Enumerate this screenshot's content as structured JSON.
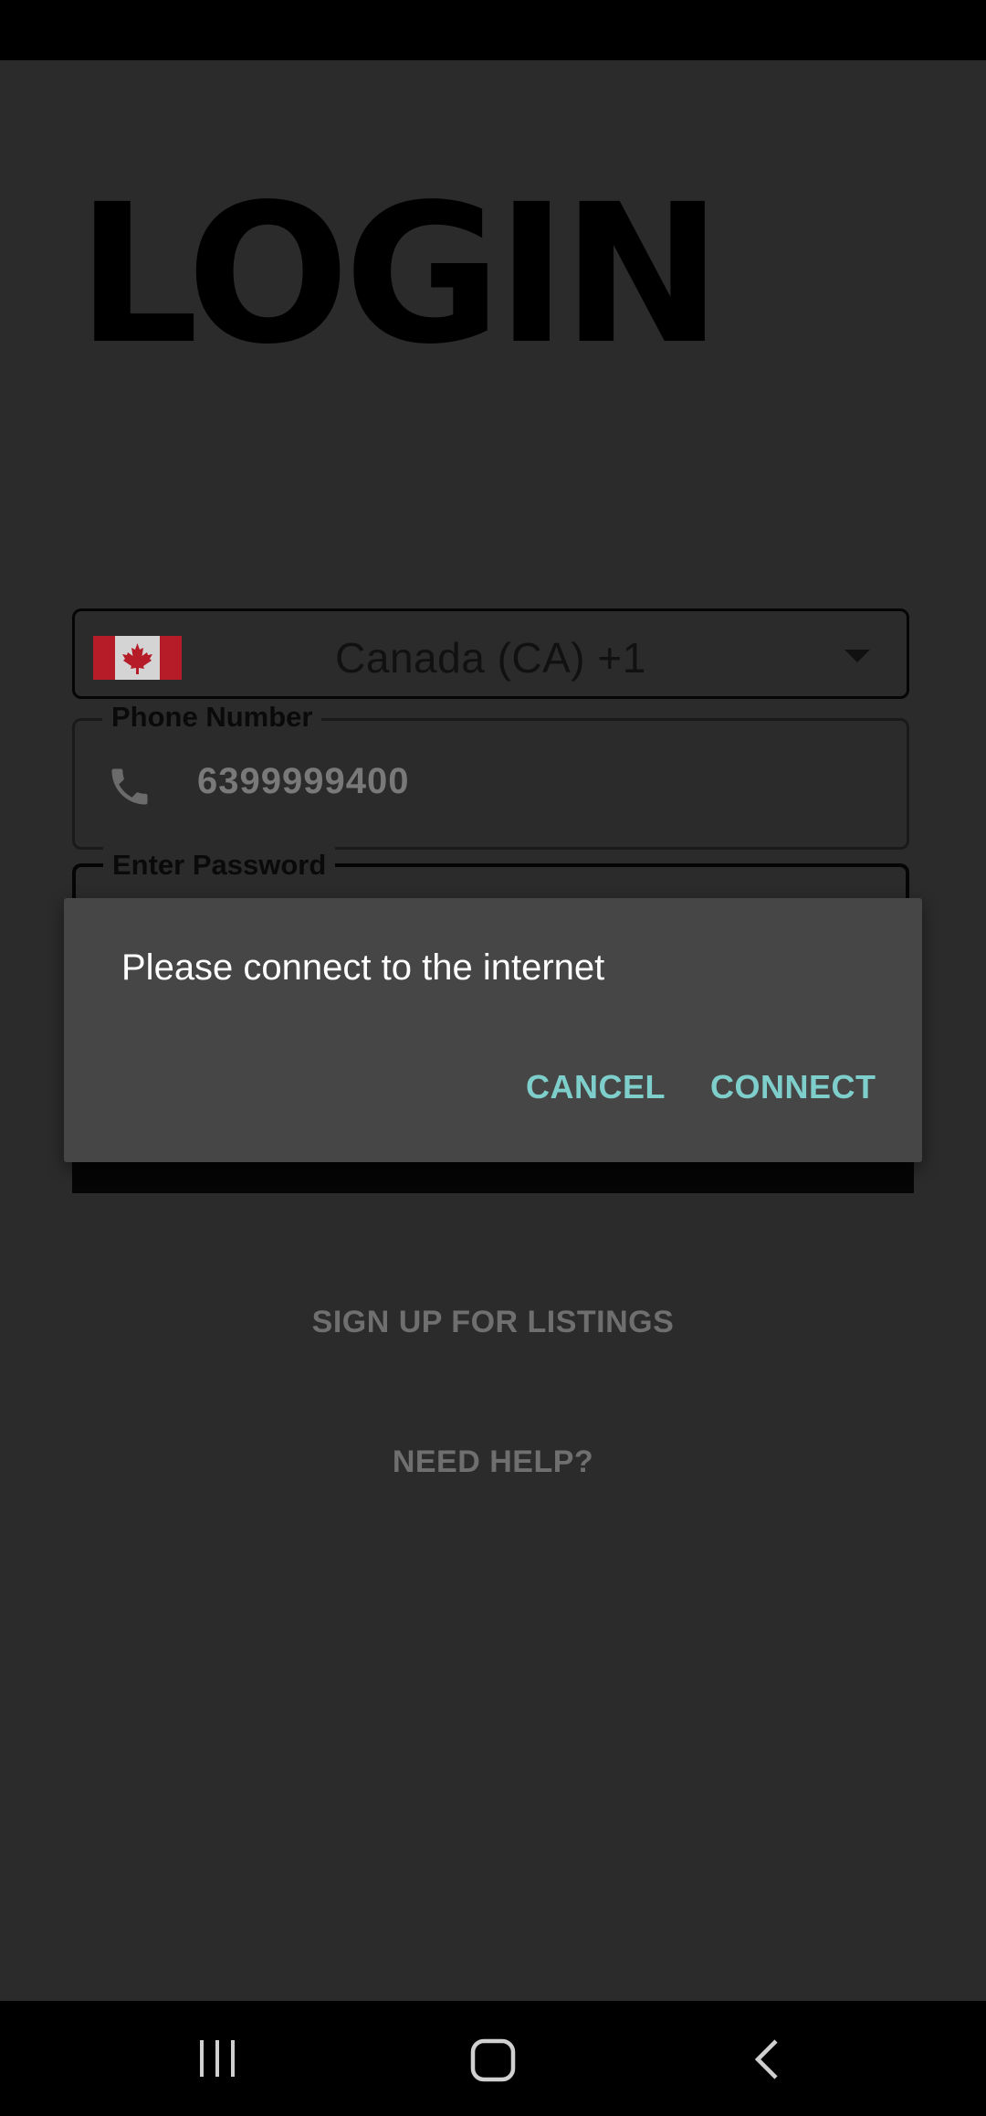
{
  "login": {
    "title": "LOGIN",
    "country": {
      "label": "Canada (CA)  +1",
      "flag_icon": "canada-flag-icon",
      "flag_colors": [
        "#c41e2a",
        "#d8d8d8"
      ]
    },
    "phone": {
      "legend": "Phone Number",
      "value": "6399999400",
      "icon": "phone-icon"
    },
    "password": {
      "legend": "Enter Password"
    },
    "signup_link": "SIGN UP FOR LISTINGS",
    "help_link": "NEED HELP?"
  },
  "dialog": {
    "message": "Please connect to the internet",
    "cancel_label": "CANCEL",
    "connect_label": "CONNECT",
    "accent_color": "#7ecfcb"
  },
  "nav": {
    "recents_icon": "recents-icon",
    "home_icon": "home-icon",
    "back_icon": "back-icon"
  }
}
